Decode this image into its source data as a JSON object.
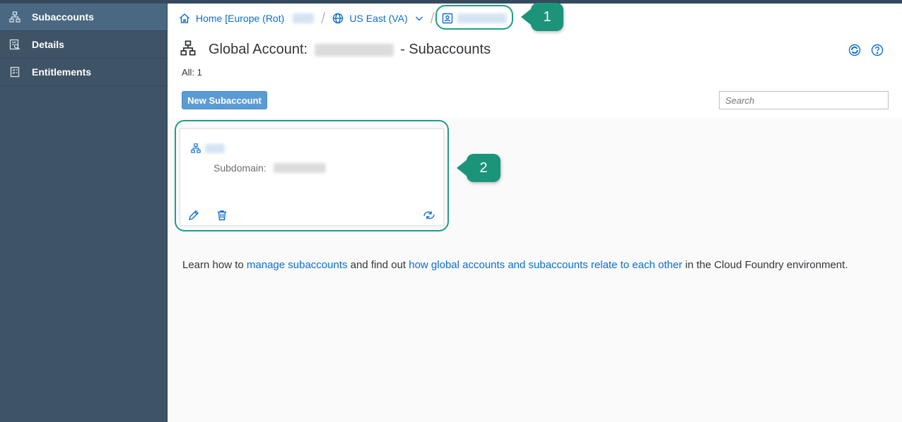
{
  "sidebar": {
    "items": [
      {
        "label": "Subaccounts",
        "icon": "hierarchy-icon",
        "active": true
      },
      {
        "label": "Details",
        "icon": "details-icon",
        "active": false
      },
      {
        "label": "Entitlements",
        "icon": "entitlements-icon",
        "active": false
      }
    ]
  },
  "breadcrumb": {
    "home_label": "Home [Europe (Rot)",
    "region_label": "US East (VA)"
  },
  "header": {
    "title_prefix": "Global Account:",
    "title_suffix": "- Subaccounts",
    "count": "All: 1"
  },
  "toolbar": {
    "new_button": "New Subaccount",
    "search_placeholder": "Search"
  },
  "card": {
    "subdomain_label": "Subdomain:"
  },
  "callouts": [
    "1",
    "2"
  ],
  "help": {
    "prefix": "Learn how to ",
    "link1": "manage subaccounts",
    "middle": " and find out ",
    "link2": "how global accounts and subaccounts relate to each other",
    "suffix": " in the Cloud Foundry environment."
  },
  "colors": {
    "sidebar": "#3f5366",
    "accent": "#0a6ed1",
    "callout": "#1b9479",
    "button": "#5b9bd5"
  }
}
